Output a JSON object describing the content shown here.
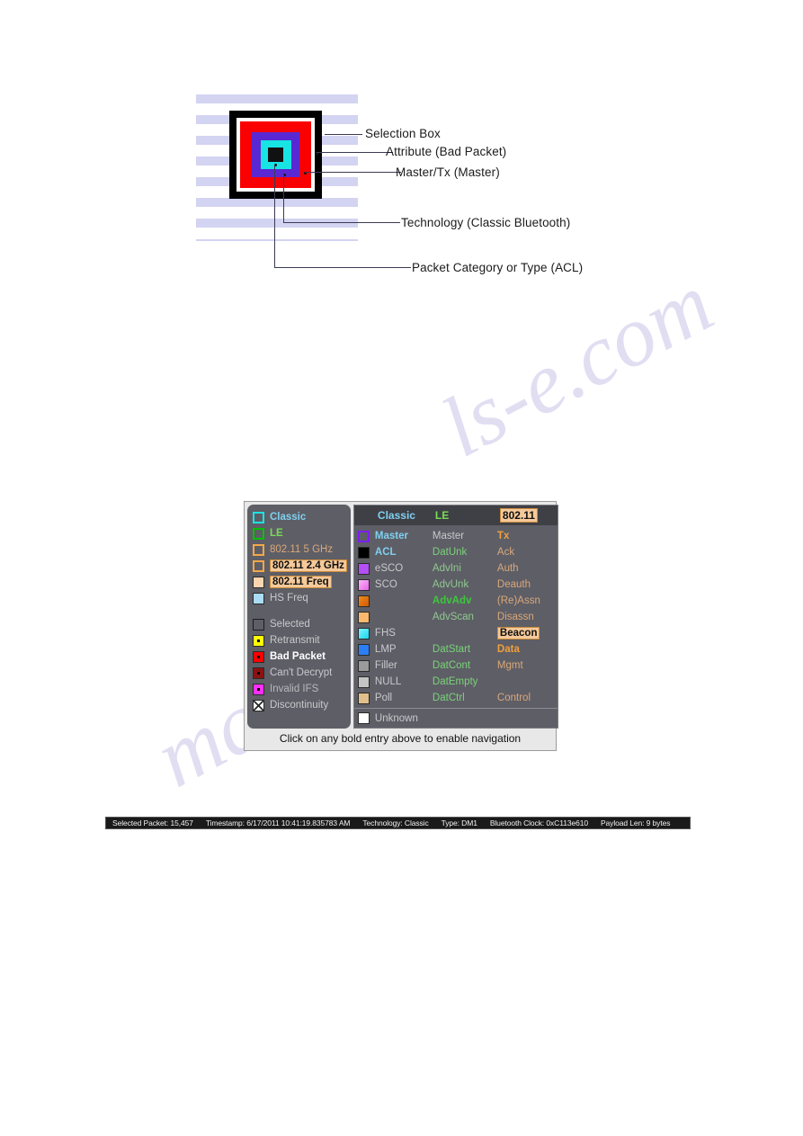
{
  "watermark": {
    "line1": "ls-e.com",
    "line2": "manualsl"
  },
  "diagram": {
    "labels": [
      {
        "text": "Selection Box"
      },
      {
        "text": "Attribute (Bad Packet)"
      },
      {
        "text": "Master/Tx (Master)"
      },
      {
        "text": "Technology (Classic Bluetooth)"
      },
      {
        "text": "Packet Category or Type (ACL)"
      }
    ],
    "layers": [
      {
        "name": "selection-box",
        "color": "#000000"
      },
      {
        "name": "white-gap",
        "color": "#ffffff"
      },
      {
        "name": "attribute-bad-packet",
        "color": "#fa0000"
      },
      {
        "name": "master-tx",
        "color": "#5a28d2"
      },
      {
        "name": "technology-classic",
        "color": "#19e4e4"
      },
      {
        "name": "packet-category-acl",
        "color": "#111111"
      }
    ]
  },
  "legend": {
    "left_column": [
      {
        "label": "Classic",
        "swatch": "#19e4e4",
        "style": "hollow",
        "text_color": "#7fd0f0",
        "bold": true,
        "highlight": false
      },
      {
        "label": "LE",
        "swatch": "#00c000",
        "style": "hollow",
        "text_color": "#77dd55",
        "bold": true,
        "highlight": false
      },
      {
        "label": "802.11 5 GHz",
        "swatch": "#f5a847",
        "style": "hollow",
        "text_color": "#d9a87a",
        "bold": false,
        "highlight": false
      },
      {
        "label": "802.11 2.4 GHz",
        "swatch": "#f5a847",
        "style": "hollow",
        "text_color": "#111111",
        "bold": true,
        "highlight": true
      },
      {
        "label": "802.11 Freq",
        "swatch": "#fbd5ae",
        "style": "solid",
        "text_color": "#111111",
        "bold": true,
        "highlight": true
      },
      {
        "label": "HS Freq",
        "swatch": "#aadcf5",
        "style": "solid",
        "text_color": "#c8c8cc",
        "bold": false,
        "highlight": false
      }
    ],
    "left_column_b": [
      {
        "label": "Selected",
        "swatch": "#5e5e66",
        "style": "outline",
        "text_color": "#c8c8cc",
        "bold": false
      },
      {
        "label": "Retransmit",
        "swatch": "#ffff00",
        "style": "dot",
        "text_color": "#c8c8cc",
        "bold": false
      },
      {
        "label": "Bad Packet",
        "swatch": "#ff0000",
        "style": "dot",
        "text_color": "#ffffff",
        "bold": true
      },
      {
        "label": "Can't Decrypt",
        "swatch": "#8b1212",
        "style": "dot",
        "text_color": "#c8c8cc",
        "bold": false
      },
      {
        "label": "Invalid IFS",
        "swatch": "#ff2fff",
        "style": "dot",
        "text_color": "#b8b8bc",
        "bold": false
      },
      {
        "label": "Discontinuity",
        "swatch": "#ffffff",
        "style": "discont",
        "text_color": "#c8c8cc",
        "bold": false
      }
    ],
    "headers": [
      {
        "label": "Classic",
        "color": "#7fd0f0",
        "highlight": false
      },
      {
        "label": "LE",
        "color": "#77dd55",
        "highlight": false
      },
      {
        "label": "802.11",
        "color": "#111111",
        "highlight": true
      }
    ],
    "rows": [
      {
        "swatch": "#7b1ff0",
        "style": "hollow",
        "classic": "Master",
        "classic_bold": true,
        "classic_color": "#7fd0f0",
        "le": "Master",
        "le_bold": false,
        "le_color": "#c8c8cc",
        "w": "Tx",
        "w_bold": true,
        "w_color": "#f0a03c",
        "w_hl": false
      },
      {
        "swatch": "#000000",
        "style": "solid",
        "classic": "ACL",
        "classic_bold": true,
        "classic_color": "#7fd0f0",
        "le": "DatUnk",
        "le_bold": false,
        "le_color": "#7ad37a",
        "w": "Ack",
        "w_bold": false,
        "w_color": "#d9a87a",
        "w_hl": false
      },
      {
        "swatch": "#b44ef5",
        "style": "solid",
        "classic": "eSCO",
        "classic_bold": false,
        "classic_color": "#c8c8cc",
        "le": "AdvIni",
        "le_bold": false,
        "le_color": "#8fc98f",
        "w": "Auth",
        "w_bold": false,
        "w_color": "#d9a87a",
        "w_hl": false
      },
      {
        "swatch": "#e963e9",
        "style": "grad-pink",
        "classic": "SCO",
        "classic_bold": false,
        "classic_color": "#c8c8cc",
        "le": "AdvUnk",
        "le_bold": false,
        "le_color": "#8fc98f",
        "w": "Deauth",
        "w_bold": false,
        "w_color": "#d9a87a",
        "w_hl": false
      },
      {
        "swatch": "#d05a06",
        "style": "grad-orange",
        "classic": "",
        "classic_bold": false,
        "classic_color": "#c8c8cc",
        "le": "AdvAdv",
        "le_bold": true,
        "le_color": "#3dc83d",
        "w": "(Re)Assn",
        "w_bold": false,
        "w_color": "#d9a87a",
        "w_hl": false
      },
      {
        "swatch": "#fbb96e",
        "style": "solid",
        "classic": "",
        "classic_bold": false,
        "classic_color": "#c8c8cc",
        "le": "AdvScan",
        "le_bold": false,
        "le_color": "#8fc98f",
        "w": "Disassn",
        "w_bold": false,
        "w_color": "#d9a87a",
        "w_hl": false
      },
      {
        "swatch": "#18d8ec",
        "style": "grad-cyan",
        "classic": "FHS",
        "classic_bold": false,
        "classic_color": "#c8c8cc",
        "le": "",
        "le_bold": false,
        "le_color": "#8fc98f",
        "w": "Beacon",
        "w_bold": true,
        "w_color": "#111111",
        "w_hl": true
      },
      {
        "swatch": "#2b7ff5",
        "style": "solid",
        "classic": "LMP",
        "classic_bold": false,
        "classic_color": "#c8c8cc",
        "le": "DatStart",
        "le_bold": false,
        "le_color": "#7ad37a",
        "w": "Data",
        "w_bold": true,
        "w_color": "#f0a03c",
        "w_hl": false
      },
      {
        "swatch": "#9a9a9a",
        "style": "solid",
        "classic": "Filler",
        "classic_bold": false,
        "classic_color": "#c8c8cc",
        "le": "DatCont",
        "le_bold": false,
        "le_color": "#7ad37a",
        "w": "Mgmt",
        "w_bold": false,
        "w_color": "#d9a87a",
        "w_hl": false
      },
      {
        "swatch": "#c4c4c4",
        "style": "solid",
        "classic": "NULL",
        "classic_bold": false,
        "classic_color": "#c8c8cc",
        "le": "DatEmpty",
        "le_bold": false,
        "le_color": "#7ad37a",
        "w": "",
        "w_bold": false,
        "w_color": "#d9a87a",
        "w_hl": false
      },
      {
        "swatch": "#e0bf8c",
        "style": "solid",
        "classic": "Poll",
        "classic_bold": false,
        "classic_color": "#c8c8cc",
        "le": "DatCtrl",
        "le_bold": false,
        "le_color": "#7ad37a",
        "w": "Control",
        "w_bold": false,
        "w_color": "#d9a87a",
        "w_hl": false
      }
    ],
    "unknown": {
      "label": "Unknown",
      "swatch": "#ffffff"
    },
    "hint": "Click on any bold entry above to enable navigation"
  },
  "statusbar": {
    "selected_packet": "Selected Packet: 15,457",
    "timestamp": "Timestamp: 6/17/2011 10:41:19.835783 AM",
    "technology": "Technology: Classic",
    "type": "Type: DM1",
    "bluetooth_clock": "Bluetooth Clock: 0xC113e610",
    "payload": "Payload Len: 9 bytes"
  }
}
